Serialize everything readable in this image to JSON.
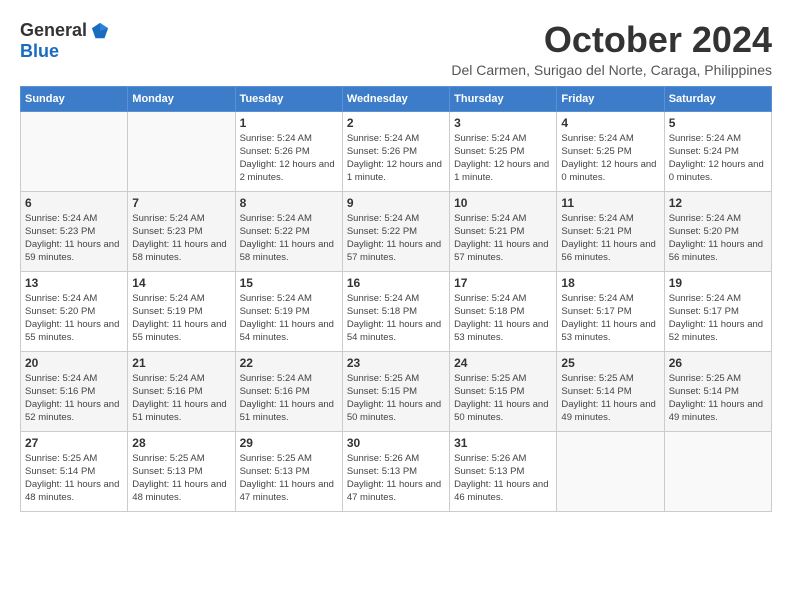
{
  "logo": {
    "general": "General",
    "blue": "Blue"
  },
  "title": "October 2024",
  "location": "Del Carmen, Surigao del Norte, Caraga, Philippines",
  "weekdays": [
    "Sunday",
    "Monday",
    "Tuesday",
    "Wednesday",
    "Thursday",
    "Friday",
    "Saturday"
  ],
  "weeks": [
    [
      {
        "day": "",
        "sunrise": "",
        "sunset": "",
        "daylight": ""
      },
      {
        "day": "",
        "sunrise": "",
        "sunset": "",
        "daylight": ""
      },
      {
        "day": "1",
        "sunrise": "Sunrise: 5:24 AM",
        "sunset": "Sunset: 5:26 PM",
        "daylight": "Daylight: 12 hours and 2 minutes."
      },
      {
        "day": "2",
        "sunrise": "Sunrise: 5:24 AM",
        "sunset": "Sunset: 5:26 PM",
        "daylight": "Daylight: 12 hours and 1 minute."
      },
      {
        "day": "3",
        "sunrise": "Sunrise: 5:24 AM",
        "sunset": "Sunset: 5:25 PM",
        "daylight": "Daylight: 12 hours and 1 minute."
      },
      {
        "day": "4",
        "sunrise": "Sunrise: 5:24 AM",
        "sunset": "Sunset: 5:25 PM",
        "daylight": "Daylight: 12 hours and 0 minutes."
      },
      {
        "day": "5",
        "sunrise": "Sunrise: 5:24 AM",
        "sunset": "Sunset: 5:24 PM",
        "daylight": "Daylight: 12 hours and 0 minutes."
      }
    ],
    [
      {
        "day": "6",
        "sunrise": "Sunrise: 5:24 AM",
        "sunset": "Sunset: 5:23 PM",
        "daylight": "Daylight: 11 hours and 59 minutes."
      },
      {
        "day": "7",
        "sunrise": "Sunrise: 5:24 AM",
        "sunset": "Sunset: 5:23 PM",
        "daylight": "Daylight: 11 hours and 58 minutes."
      },
      {
        "day": "8",
        "sunrise": "Sunrise: 5:24 AM",
        "sunset": "Sunset: 5:22 PM",
        "daylight": "Daylight: 11 hours and 58 minutes."
      },
      {
        "day": "9",
        "sunrise": "Sunrise: 5:24 AM",
        "sunset": "Sunset: 5:22 PM",
        "daylight": "Daylight: 11 hours and 57 minutes."
      },
      {
        "day": "10",
        "sunrise": "Sunrise: 5:24 AM",
        "sunset": "Sunset: 5:21 PM",
        "daylight": "Daylight: 11 hours and 57 minutes."
      },
      {
        "day": "11",
        "sunrise": "Sunrise: 5:24 AM",
        "sunset": "Sunset: 5:21 PM",
        "daylight": "Daylight: 11 hours and 56 minutes."
      },
      {
        "day": "12",
        "sunrise": "Sunrise: 5:24 AM",
        "sunset": "Sunset: 5:20 PM",
        "daylight": "Daylight: 11 hours and 56 minutes."
      }
    ],
    [
      {
        "day": "13",
        "sunrise": "Sunrise: 5:24 AM",
        "sunset": "Sunset: 5:20 PM",
        "daylight": "Daylight: 11 hours and 55 minutes."
      },
      {
        "day": "14",
        "sunrise": "Sunrise: 5:24 AM",
        "sunset": "Sunset: 5:19 PM",
        "daylight": "Daylight: 11 hours and 55 minutes."
      },
      {
        "day": "15",
        "sunrise": "Sunrise: 5:24 AM",
        "sunset": "Sunset: 5:19 PM",
        "daylight": "Daylight: 11 hours and 54 minutes."
      },
      {
        "day": "16",
        "sunrise": "Sunrise: 5:24 AM",
        "sunset": "Sunset: 5:18 PM",
        "daylight": "Daylight: 11 hours and 54 minutes."
      },
      {
        "day": "17",
        "sunrise": "Sunrise: 5:24 AM",
        "sunset": "Sunset: 5:18 PM",
        "daylight": "Daylight: 11 hours and 53 minutes."
      },
      {
        "day": "18",
        "sunrise": "Sunrise: 5:24 AM",
        "sunset": "Sunset: 5:17 PM",
        "daylight": "Daylight: 11 hours and 53 minutes."
      },
      {
        "day": "19",
        "sunrise": "Sunrise: 5:24 AM",
        "sunset": "Sunset: 5:17 PM",
        "daylight": "Daylight: 11 hours and 52 minutes."
      }
    ],
    [
      {
        "day": "20",
        "sunrise": "Sunrise: 5:24 AM",
        "sunset": "Sunset: 5:16 PM",
        "daylight": "Daylight: 11 hours and 52 minutes."
      },
      {
        "day": "21",
        "sunrise": "Sunrise: 5:24 AM",
        "sunset": "Sunset: 5:16 PM",
        "daylight": "Daylight: 11 hours and 51 minutes."
      },
      {
        "day": "22",
        "sunrise": "Sunrise: 5:24 AM",
        "sunset": "Sunset: 5:16 PM",
        "daylight": "Daylight: 11 hours and 51 minutes."
      },
      {
        "day": "23",
        "sunrise": "Sunrise: 5:25 AM",
        "sunset": "Sunset: 5:15 PM",
        "daylight": "Daylight: 11 hours and 50 minutes."
      },
      {
        "day": "24",
        "sunrise": "Sunrise: 5:25 AM",
        "sunset": "Sunset: 5:15 PM",
        "daylight": "Daylight: 11 hours and 50 minutes."
      },
      {
        "day": "25",
        "sunrise": "Sunrise: 5:25 AM",
        "sunset": "Sunset: 5:14 PM",
        "daylight": "Daylight: 11 hours and 49 minutes."
      },
      {
        "day": "26",
        "sunrise": "Sunrise: 5:25 AM",
        "sunset": "Sunset: 5:14 PM",
        "daylight": "Daylight: 11 hours and 49 minutes."
      }
    ],
    [
      {
        "day": "27",
        "sunrise": "Sunrise: 5:25 AM",
        "sunset": "Sunset: 5:14 PM",
        "daylight": "Daylight: 11 hours and 48 minutes."
      },
      {
        "day": "28",
        "sunrise": "Sunrise: 5:25 AM",
        "sunset": "Sunset: 5:13 PM",
        "daylight": "Daylight: 11 hours and 48 minutes."
      },
      {
        "day": "29",
        "sunrise": "Sunrise: 5:25 AM",
        "sunset": "Sunset: 5:13 PM",
        "daylight": "Daylight: 11 hours and 47 minutes."
      },
      {
        "day": "30",
        "sunrise": "Sunrise: 5:26 AM",
        "sunset": "Sunset: 5:13 PM",
        "daylight": "Daylight: 11 hours and 47 minutes."
      },
      {
        "day": "31",
        "sunrise": "Sunrise: 5:26 AM",
        "sunset": "Sunset: 5:13 PM",
        "daylight": "Daylight: 11 hours and 46 minutes."
      },
      {
        "day": "",
        "sunrise": "",
        "sunset": "",
        "daylight": ""
      },
      {
        "day": "",
        "sunrise": "",
        "sunset": "",
        "daylight": ""
      }
    ]
  ]
}
